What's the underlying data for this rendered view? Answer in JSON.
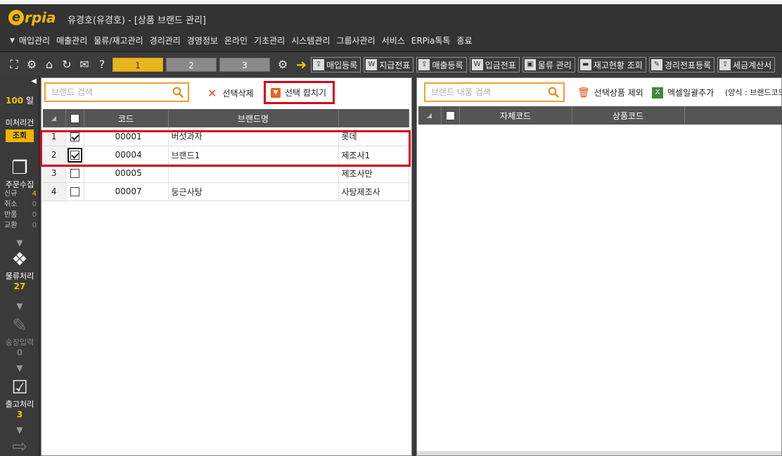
{
  "window": {
    "logo_letter": "e",
    "logo_text": "rpia",
    "title": "유경호(유경호) - [상품 브랜드 관리]"
  },
  "menu": {
    "items": [
      "매입관리",
      "매출관리",
      "물류/재고관리",
      "경리관리",
      "경영정보",
      "온라인",
      "기초관리",
      "시스템관리",
      "그룹사관리",
      "서비스",
      "ERPia톡톡",
      "종료"
    ]
  },
  "toolbar": {
    "page_tabs": [
      "1",
      "2",
      "3"
    ],
    "buttons": [
      {
        "label": "매입등록",
        "icon": "upload-icon"
      },
      {
        "label": "지급전표",
        "icon": "document-icon"
      },
      {
        "label": "매출등록",
        "icon": "upload-icon"
      },
      {
        "label": "입금전표",
        "icon": "document-icon"
      },
      {
        "label": "물류 관리",
        "icon": "truck-icon"
      },
      {
        "label": "재고현황 조회",
        "icon": "box-icon"
      },
      {
        "label": "경리전표등록",
        "icon": "edit-icon"
      },
      {
        "label": "세금계산서",
        "icon": "upload-icon"
      }
    ]
  },
  "sidebar": {
    "days_value": "100",
    "days_unit": "일",
    "pending_label": "미처리건",
    "view_button": "조회",
    "order_collect": {
      "label": "주문수집"
    },
    "order_stats": [
      {
        "label": "신규",
        "value": "4"
      },
      {
        "label": "취소",
        "value": "0"
      },
      {
        "label": "반품",
        "value": "0"
      },
      {
        "label": "교환",
        "value": "0"
      }
    ],
    "logistics": {
      "label": "물류처리",
      "count": "27"
    },
    "invoice": {
      "label": "송장입력",
      "count": "0"
    },
    "shipping": {
      "label": "출고처리",
      "count": "3"
    }
  },
  "left_panel": {
    "search_placeholder": "브랜드 검색",
    "delete_button": "선택삭제",
    "merge_button": "선택 합치기",
    "columns": [
      "코드",
      "브랜드명",
      ""
    ],
    "rows": [
      {
        "num": "1",
        "checked": true,
        "code": "00001",
        "brand": "버섯과자",
        "maker": "롯데"
      },
      {
        "num": "2",
        "checked": true,
        "code": "00004",
        "brand": "브랜드1",
        "maker": "제조사1"
      },
      {
        "num": "3",
        "checked": false,
        "code": "00005",
        "brand": "",
        "maker": "제조사만"
      },
      {
        "num": "4",
        "checked": false,
        "code": "00007",
        "brand": "둥근사탕",
        "maker": "사탕제조사"
      }
    ]
  },
  "right_panel": {
    "search_placeholder": "브랜드 내품 검색",
    "exclude_button": "선택상품 제외",
    "excel_button": "엑셀일괄추가",
    "format_note": "(양식 : 브랜드코드",
    "columns": [
      "자체코드",
      "상품코드"
    ]
  }
}
